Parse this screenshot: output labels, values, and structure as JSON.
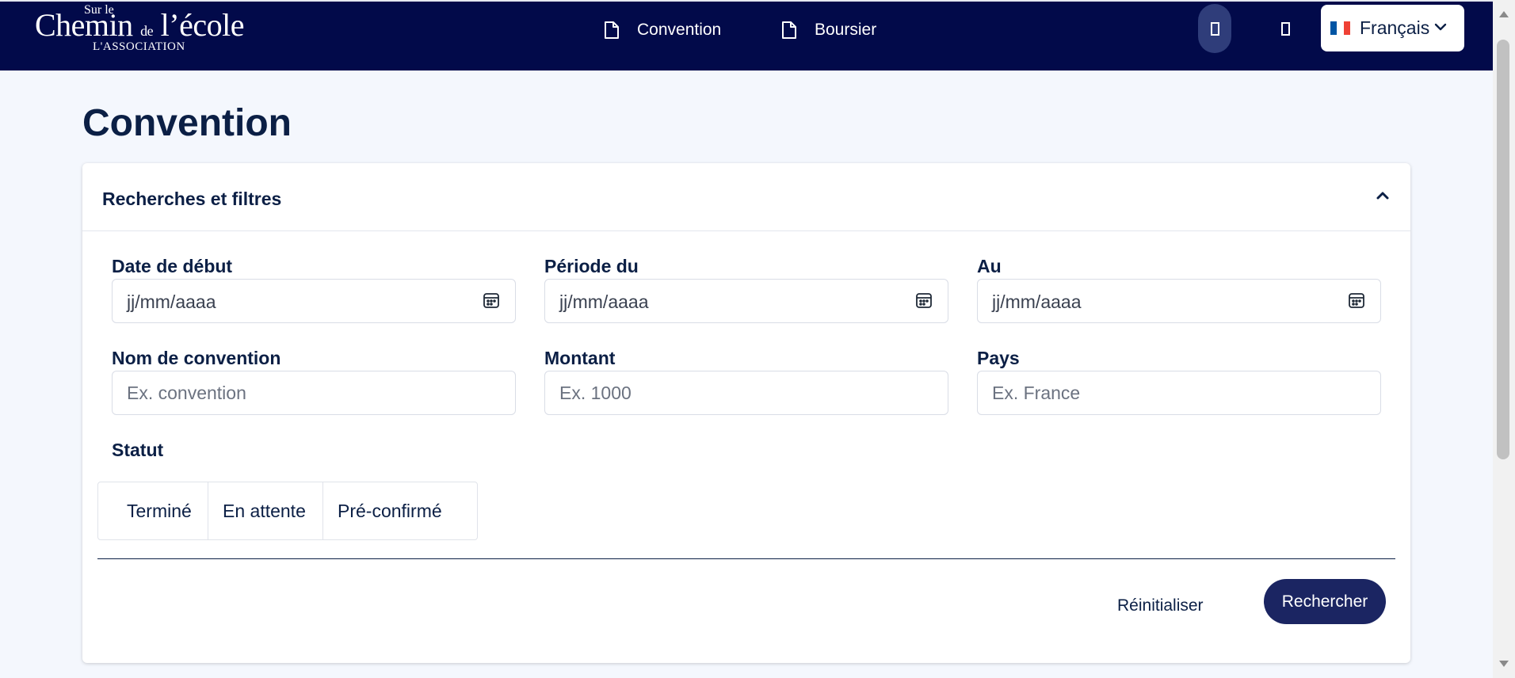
{
  "header": {
    "logo": {
      "line_top": "Sur le",
      "main_left": "Chemin",
      "main_small": "de",
      "main_right": "l’école",
      "line_bottom": "L'ASSOCIATION"
    },
    "nav": [
      {
        "label": "Convention",
        "icon": "document-icon"
      },
      {
        "label": "Boursier",
        "icon": "document-icon"
      }
    ],
    "language": {
      "label": "Français",
      "flag": "french-flag-icon",
      "colors": [
        "#0055a4",
        "#ffffff",
        "#ef4135"
      ]
    }
  },
  "page": {
    "title": "Convention"
  },
  "filters": {
    "title": "Recherches et filtres",
    "fields": {
      "date_debut": {
        "label": "Date de début",
        "value": "jj/mm/aaaa"
      },
      "periode_du": {
        "label": "Période du",
        "value": "jj/mm/aaaa"
      },
      "au": {
        "label": "Au",
        "value": "jj/mm/aaaa"
      },
      "nom_convention": {
        "label": "Nom de convention",
        "placeholder": "Ex. convention"
      },
      "montant": {
        "label": "Montant",
        "placeholder": "Ex. 1000"
      },
      "pays": {
        "label": "Pays",
        "placeholder": "Ex. France"
      }
    },
    "statut": {
      "label": "Statut",
      "options": [
        "Terminé",
        "En attente",
        "Pré-confirmé"
      ]
    },
    "actions": {
      "reset": "Réinitialiser",
      "search": "Rechercher"
    }
  },
  "colors": {
    "header_bg": "#020a4a",
    "primary_button": "#1b2562",
    "text": "#0b1f45",
    "page_bg": "#f4f7fd"
  }
}
